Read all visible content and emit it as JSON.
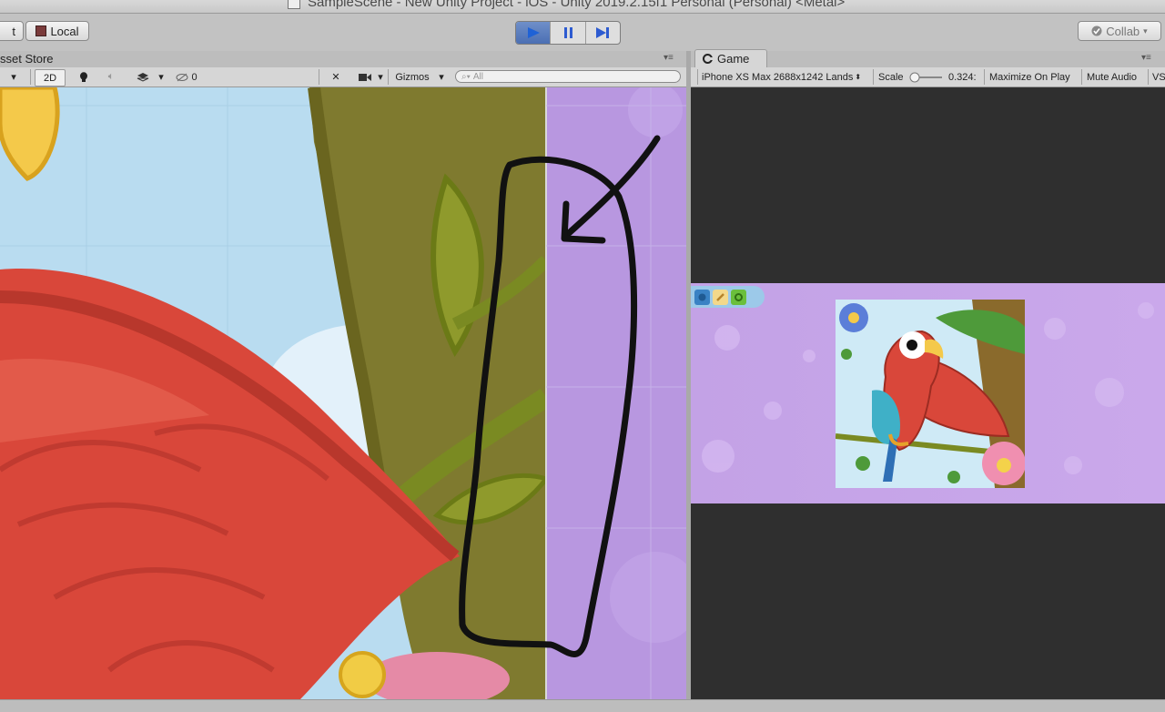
{
  "window": {
    "title": "SampleScene - New Unity Project - iOS - Unity 2019.2.15f1 Personal (Personal) <Metal>"
  },
  "toolbar": {
    "left_button_partial": "t",
    "local_label": "Local",
    "collab_label": "Collab",
    "play_icons": [
      "play-icon",
      "pause-icon",
      "step-icon"
    ],
    "play_active_color": "#4b6fb3"
  },
  "scene_panel": {
    "tab_label": "sset Store",
    "mode_2d": "2D",
    "hidden_count": "0",
    "gizmos_label": "Gizmos",
    "search_placeholder": "All"
  },
  "game_panel": {
    "tab_label": "Game",
    "resolution": "iPhone XS Max 2688x1242 Lands",
    "scale_label": "Scale",
    "scale_value": "0.324",
    "maximize_label": "Maximize On Play",
    "mute_label": "Mute Audio",
    "stats_partial": "VS",
    "game_icons": [
      "gear-icon",
      "brush-icon",
      "settings-icon"
    ]
  },
  "colors": {
    "canvas_purple": "#b897e0",
    "sky_blue": "#b9dcf0",
    "parrot_red": "#d9473a",
    "trunk_olive": "#7f7a2f",
    "annotation_ink": "#111111"
  }
}
